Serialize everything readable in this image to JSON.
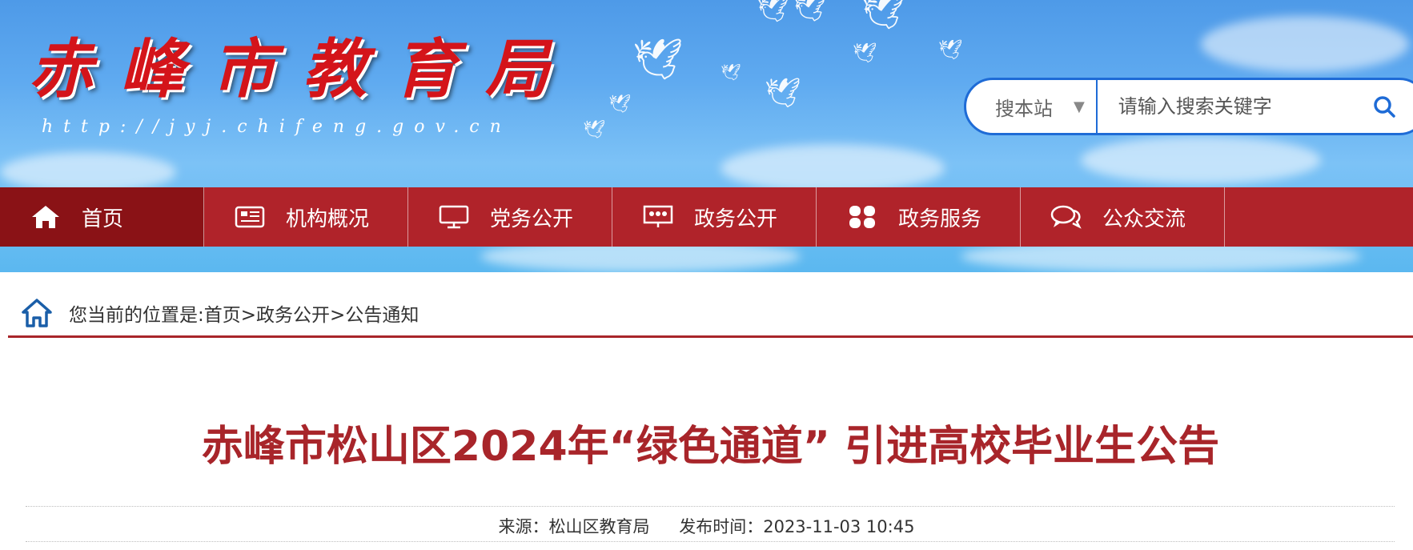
{
  "header": {
    "site_title": "赤峰市教育局",
    "site_url": "http://jyj.chifeng.gov.cn"
  },
  "search": {
    "scope": "搜本站",
    "placeholder": "请输入搜索关键字",
    "icon": "search-icon"
  },
  "nav": {
    "items": [
      {
        "label": "首页",
        "icon": "home-icon"
      },
      {
        "label": "机构概况",
        "icon": "newspaper-icon"
      },
      {
        "label": "党务公开",
        "icon": "monitor-icon"
      },
      {
        "label": "政务公开",
        "icon": "presentation-icon"
      },
      {
        "label": "政务服务",
        "icon": "grid-icon"
      },
      {
        "label": "公众交流",
        "icon": "chat-icon"
      }
    ]
  },
  "breadcrumb": {
    "prefix": "您当前的位置是:",
    "items": [
      "首页",
      "政务公开",
      "公告通知"
    ],
    "separator": ">"
  },
  "article": {
    "title": "赤峰市松山区2024年“绿色通道” 引进高校毕业生公告",
    "source": "来源：松山区教育局",
    "published": "发布时间：2023-11-03 10:45"
  },
  "colors": {
    "nav_bg": "#b0232a",
    "nav_active": "#8a1216",
    "title": "#a8252a",
    "search_border": "#1e6bd6"
  }
}
